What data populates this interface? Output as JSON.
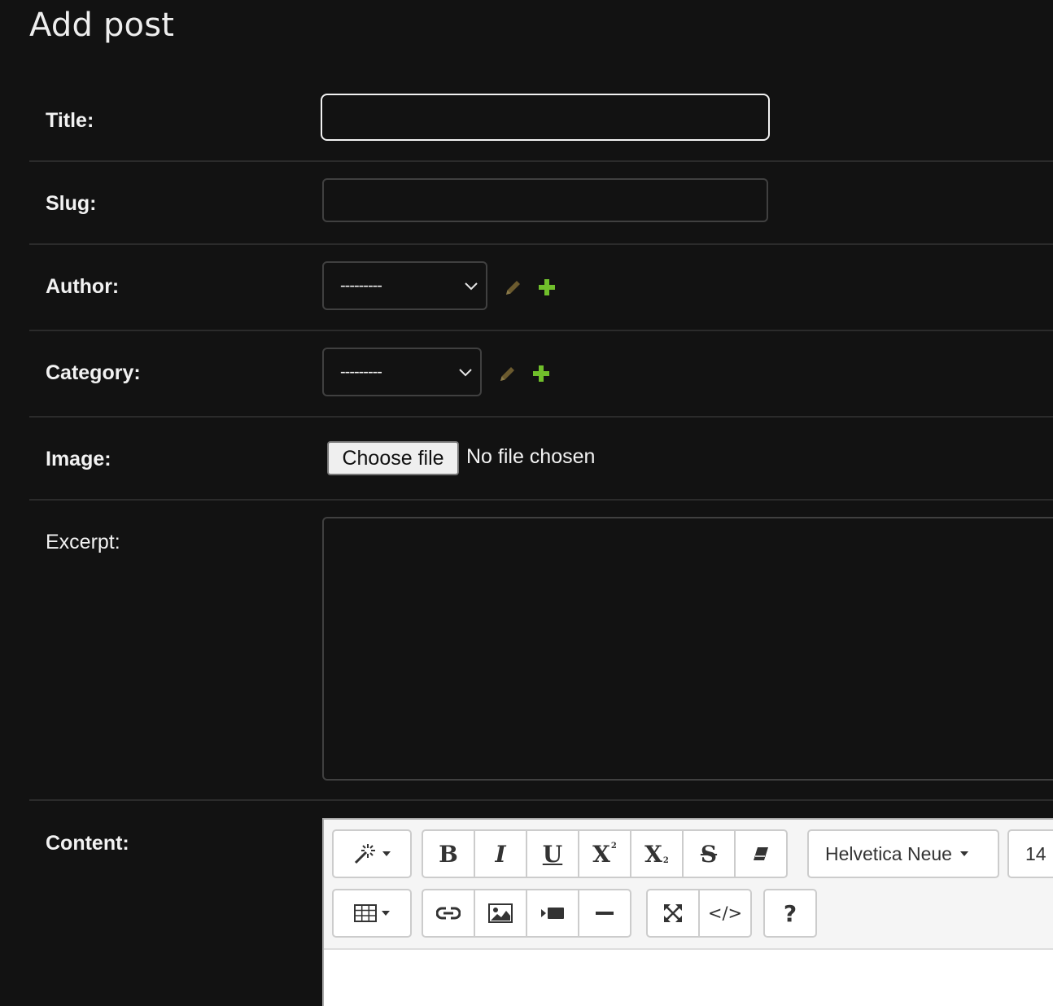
{
  "page": {
    "title": "Add post"
  },
  "fields": {
    "title": {
      "label": "Title:",
      "value": ""
    },
    "slug": {
      "label": "Slug:",
      "value": ""
    },
    "author": {
      "label": "Author:",
      "selected": "---------"
    },
    "category": {
      "label": "Category:",
      "selected": "---------"
    },
    "image": {
      "label": "Image:",
      "button": "Choose file",
      "status": "No file chosen"
    },
    "excerpt": {
      "label": "Excerpt:",
      "value": ""
    },
    "content": {
      "label": "Content:"
    }
  },
  "editor": {
    "font_name": "Helvetica Neue",
    "font_size": "14",
    "toolbar_row1": [
      "style-magic",
      "bold",
      "italic",
      "underline",
      "superscript",
      "subscript",
      "strikethrough",
      "clear-format",
      "font-name",
      "font-size"
    ],
    "toolbar_row2": [
      "table",
      "link",
      "picture",
      "video",
      "horizontal-rule",
      "fullscreen",
      "code-view",
      "help"
    ],
    "glyphs": {
      "bold": "B",
      "italic": "I",
      "underline": "U",
      "superscript": "X",
      "subscript": "X",
      "strikethrough": "S",
      "code": "</>",
      "help": "?"
    }
  },
  "colors": {
    "background": "#121212",
    "text": "#f2f2f2",
    "input_border": "#404040",
    "focus_border": "#f2f2f2",
    "edit_icon": "#6b5a2e",
    "add_icon": "#70bf2b"
  }
}
